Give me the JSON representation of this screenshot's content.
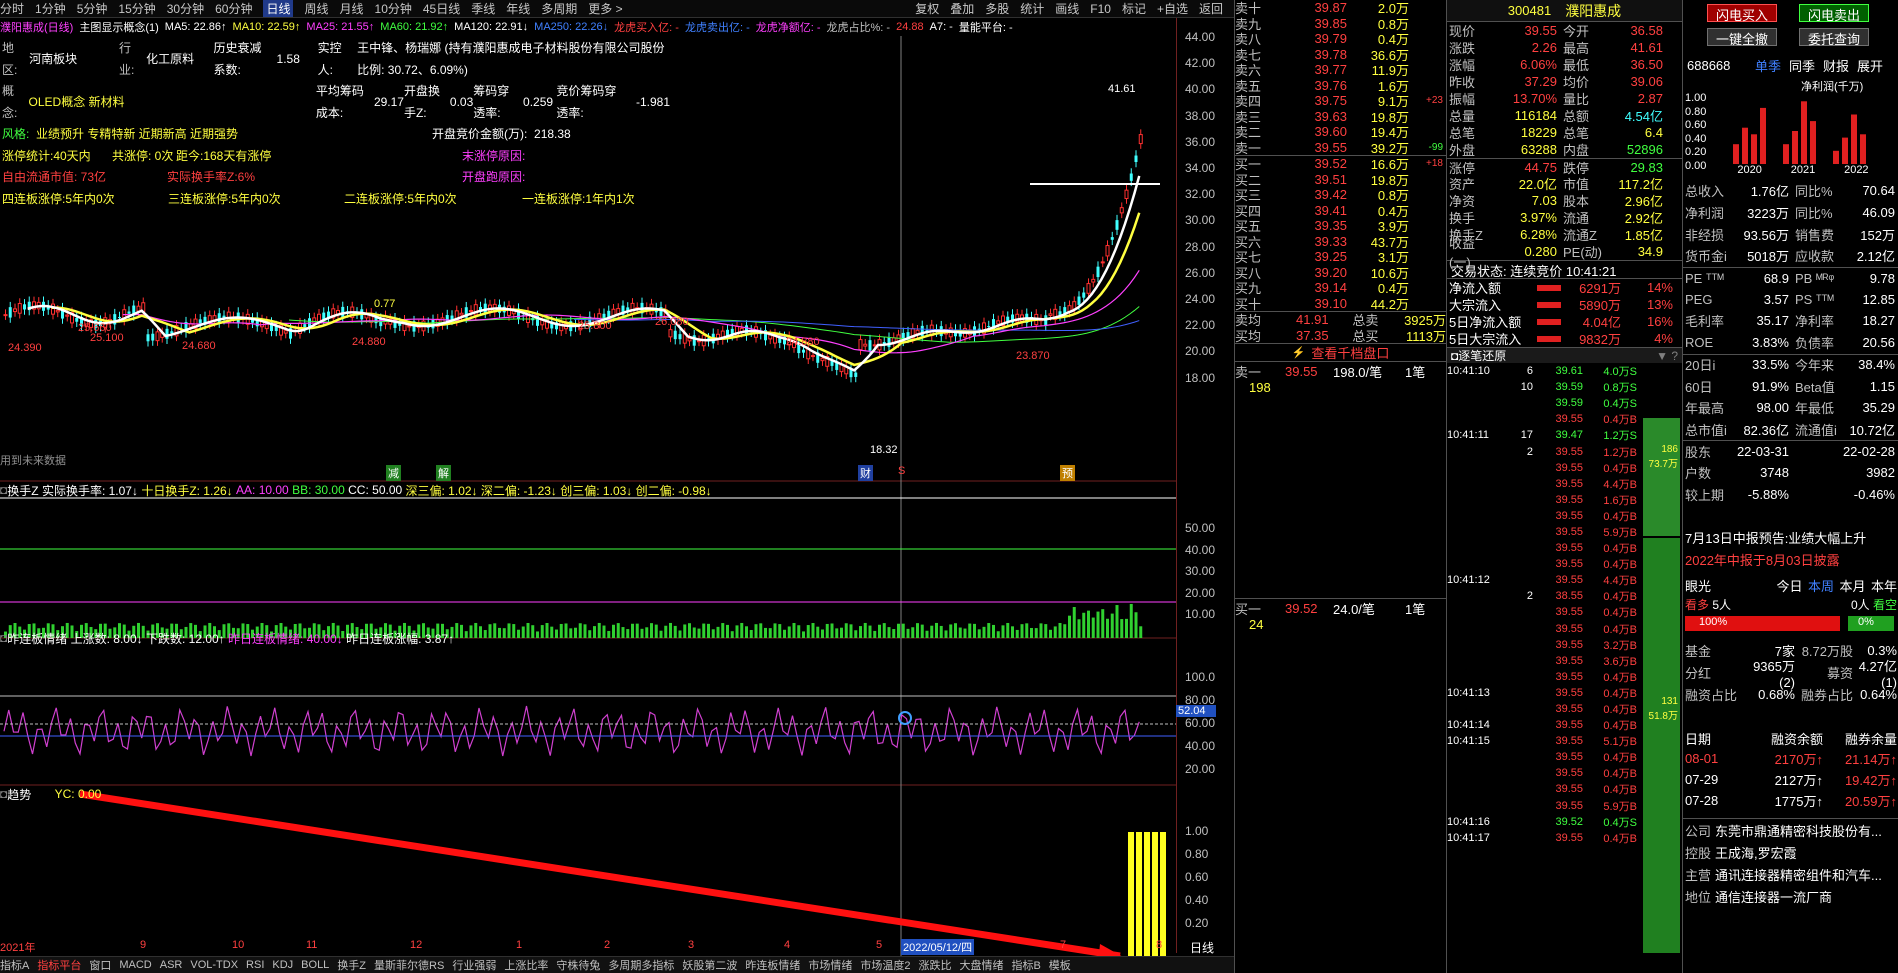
{
  "toolbar": {
    "items": [
      "分时",
      "1分钟",
      "5分钟",
      "15分钟",
      "30分钟",
      "60分钟",
      "日线",
      "周线",
      "月线",
      "10分钟",
      "45日线",
      "季线",
      "年线",
      "多周期",
      "更多 >"
    ],
    "active": "日线",
    "right": [
      "复权",
      "叠加",
      "多股",
      "统计",
      "画线",
      "F10",
      "标记",
      "+自选",
      "返回"
    ]
  },
  "ma_line": {
    "name": "濮阳惠成(日线)",
    "concept": "主图显示概念(1)",
    "ma5": "MA5: 22.86↑",
    "ma10": "MA10: 22.59↑",
    "ma25": "MA25: 21.55↑",
    "ma60": "MA60: 21.92↑",
    "ma120": "MA120: 22.91↓",
    "ma250": "MA250: 22.26↓",
    "a": "龙虎买入亿: -",
    "b": "龙虎卖出亿: -",
    "c": "龙虎净额亿: -",
    "d": "龙虎占比%: -",
    "e": "24.88",
    "f": "A7: -",
    "g": "量能平台: -"
  },
  "info": {
    "r1": [
      "地区:",
      "河南板块",
      "行业:",
      "化工原料",
      "历史衰减系数:",
      "1.58",
      "实控人:",
      "王中锋、杨瑞娜 (持有濮阳惠成电子材料股份有限公司股份比例: 30.72、6.09%)"
    ],
    "r2": [
      "概念:",
      "OLED概念 新材料",
      "平均筹码成本:",
      "29.17",
      "开盘换手Z:",
      "0.03",
      "筹码穿透率:",
      "0.259",
      "竞价筹码穿透率:",
      "-1.981"
    ],
    "r3": [
      "风格:",
      "业绩预升 专精特新 近期新高 近期强势",
      "开盘竞价金额(万):",
      "218.38"
    ],
    "r4": [
      "涨停统计:40天内",
      "共涨停: 0次",
      "距今:168天有涨停",
      "末涨停原因:"
    ],
    "r5": [
      "自由流通市值: 73亿",
      "实际换手率Z:6%",
      "开盘跑原因:"
    ],
    "r6": [
      "四连板涨停:5年内0次",
      "三连板涨停:5年内0次",
      "二连板涨停:5年内0次",
      "一连板涨停:1年内1次"
    ]
  },
  "chart_labels": {
    "hi": "41.61",
    "lo": "18.32",
    "p1": "24.390",
    "p2": "25.660",
    "p3": "25.100",
    "p4": "24.680",
    "p5": "24.880",
    "p6": "25.800",
    "p7": "26.080",
    "p8": "24.880",
    "p9": "23.870",
    "p10": "0.77",
    "note": "用到未来数据",
    "m1": "减",
    "m2": "解",
    "m3": "财",
    "m4": "S",
    "m5": "预"
  },
  "axis_main": [
    "44.00",
    "42.00",
    "40.00",
    "38.00",
    "36.00",
    "34.00",
    "32.00",
    "30.00",
    "28.00",
    "26.00",
    "24.00",
    "22.00",
    "20.00",
    "18.00"
  ],
  "panel2": {
    "title": "换手Z",
    "items": [
      "实际换手率: 1.07↓",
      "十日换手Z: 1.26↓",
      "AA: 10.00",
      "BB: 30.00",
      "CC: 50.00",
      "深三偏: 1.02↓",
      "深二偏: -1.23↓",
      "创三偏: 1.03↓",
      "创二偏: -0.98↓"
    ],
    "axis": [
      "50.00",
      "40.00",
      "30.00",
      "20.00",
      "10.00"
    ]
  },
  "panel3": {
    "title": "昨连板情绪",
    "items": [
      "上涨数: 8.00↓",
      "下跌数: 12.00↑",
      "昨日连板情绪: 40.00↓",
      "昨日连板涨幅: 3.87↑"
    ],
    "axis": [
      "100.0",
      "80.00",
      "60.00",
      "40.00",
      "20.00"
    ],
    "cur": "52.04"
  },
  "panel4": {
    "title": "趋势",
    "items": [
      "YC: 0.00"
    ],
    "axis": [
      "1.00",
      "0.80",
      "0.60",
      "0.40",
      "0.20"
    ]
  },
  "time_axis": {
    "labels": [
      "2021年",
      "9",
      "10",
      "11",
      "12",
      "1",
      "2",
      "3",
      "4",
      "5",
      "6",
      "7",
      "8"
    ],
    "cursor": "2022/05/12/四",
    "right": "日线"
  },
  "bottom_tabs": [
    "指标A",
    "指标平台",
    "窗口",
    "MACD",
    "ASR",
    "VOL-TDX",
    "RSI",
    "KDJ",
    "BOLL",
    "换手Z",
    "量斯菲尔德RS",
    "行业强弱",
    "上涨比率",
    "守株待兔",
    "多周期多指标",
    "妖股第二波",
    "昨连板情绪",
    "市场情绪",
    "市场温度2",
    "涨跌比",
    "大盘情绪",
    "指标B",
    "模板"
  ],
  "orderbook": {
    "sell": [
      [
        "卖十",
        "39.87",
        "2.0万",
        ""
      ],
      [
        "卖九",
        "39.85",
        "0.8万",
        ""
      ],
      [
        "卖八",
        "39.79",
        "0.4万",
        ""
      ],
      [
        "卖七",
        "39.78",
        "36.6万",
        ""
      ],
      [
        "卖六",
        "39.77",
        "11.9万",
        ""
      ],
      [
        "卖五",
        "39.76",
        "1.6万",
        ""
      ],
      [
        "卖四",
        "39.75",
        "9.1万",
        "+23"
      ],
      [
        "卖三",
        "39.63",
        "19.8万",
        ""
      ],
      [
        "卖二",
        "39.60",
        "19.4万",
        ""
      ],
      [
        "卖一",
        "39.55",
        "39.2万",
        "-99"
      ]
    ],
    "buy": [
      [
        "买一",
        "39.52",
        "16.6万",
        "+18"
      ],
      [
        "买二",
        "39.51",
        "19.8万",
        ""
      ],
      [
        "买三",
        "39.42",
        "0.8万",
        ""
      ],
      [
        "买四",
        "39.41",
        "0.4万",
        ""
      ],
      [
        "买五",
        "39.35",
        "3.9万",
        ""
      ],
      [
        "买六",
        "39.33",
        "43.7万",
        ""
      ],
      [
        "买七",
        "39.25",
        "3.1万",
        ""
      ],
      [
        "买八",
        "39.20",
        "10.6万",
        ""
      ],
      [
        "买九",
        "39.14",
        "0.4万",
        ""
      ],
      [
        "买十",
        "39.10",
        "44.2万",
        ""
      ]
    ],
    "avg": [
      [
        "卖均",
        "41.91",
        "总卖",
        "3925万"
      ],
      [
        "买均",
        "37.35",
        "总买",
        "1113万"
      ]
    ],
    "link": "查看千档盘口"
  },
  "queue": {
    "sell": [
      "卖一",
      "39.55",
      "198.0/笔",
      "1笔",
      "198"
    ],
    "buy": [
      "买一",
      "39.52",
      "24.0/笔",
      "1笔",
      "24"
    ]
  },
  "header": {
    "code": "300481",
    "name": "濮阳惠成"
  },
  "quote": [
    [
      "现价",
      "39.55",
      "今开",
      "36.58"
    ],
    [
      "涨跌",
      "2.26",
      "最高",
      "41.61"
    ],
    [
      "涨幅",
      "6.06%",
      "最低",
      "36.50"
    ],
    [
      "昨收",
      "37.29",
      "均价",
      "39.06"
    ],
    [
      "振幅",
      "13.70%",
      "量比",
      "2.87"
    ],
    [
      "总量",
      "116184",
      "总额",
      "4.54亿"
    ],
    [
      "总笔",
      "18229",
      "总笔",
      "6.4"
    ],
    [
      "外盘",
      "63288",
      "内盘",
      "52896"
    ],
    [
      "涨停",
      "44.75",
      "跌停",
      "29.83"
    ],
    [
      "资产",
      "22.0亿",
      "市值",
      "117.2亿"
    ],
    [
      "净资",
      "7.03",
      "股本",
      "2.96亿"
    ],
    [
      "换手",
      "3.97%",
      "流通",
      "2.92亿"
    ],
    [
      "换手Z",
      "6.28%",
      "流通Z",
      "1.85亿"
    ],
    [
      "收益(一)",
      "0.280",
      "PE(动)",
      "34.9"
    ]
  ],
  "status": "交易状态: 连续竞价  10:41:21",
  "flows": [
    [
      "净流入额",
      "6291万",
      "14%"
    ],
    [
      "大宗流入",
      "5890万",
      "13%"
    ],
    [
      "5日净流入额",
      "4.04亿",
      "16%"
    ],
    [
      "5日大宗流入",
      "9832万",
      "4%"
    ]
  ],
  "tick_title": "逐笔还原",
  "ticks": [
    [
      "10:41:10",
      "6",
      "39.61",
      "4.0万S"
    ],
    [
      "",
      "10",
      "39.59",
      "0.8万S"
    ],
    [
      "",
      "",
      "39.59",
      "0.4万S"
    ],
    [
      "",
      "",
      "39.55",
      "0.4万B"
    ],
    [
      "10:41:11",
      "17",
      "39.47",
      "1.2万S"
    ],
    [
      "",
      "2",
      "39.55",
      "1.2万B"
    ],
    [
      "",
      "",
      "39.55",
      "0.4万B"
    ],
    [
      "",
      "",
      "39.55",
      "4.4万B"
    ],
    [
      "",
      "",
      "39.55",
      "1.6万B"
    ],
    [
      "",
      "",
      "39.55",
      "0.4万B"
    ],
    [
      "",
      "",
      "39.55",
      "5.9万B"
    ],
    [
      "",
      "",
      "39.55",
      "0.4万B"
    ],
    [
      "",
      "",
      "39.55",
      "0.4万B"
    ],
    [
      "10:41:12",
      "",
      "39.55",
      "4.4万B"
    ],
    [
      "",
      "2",
      "38.55",
      "0.4万B"
    ],
    [
      "",
      "",
      "39.55",
      "0.4万B"
    ],
    [
      "",
      "",
      "39.55",
      "0.4万B"
    ],
    [
      "",
      "",
      "39.55",
      "3.2万B"
    ],
    [
      "",
      "",
      "39.55",
      "3.6万B"
    ],
    [
      "",
      "",
      "39.55",
      "0.4万B"
    ],
    [
      "10:41:13",
      "",
      "39.55",
      "0.4万B"
    ],
    [
      "",
      "",
      "39.55",
      "0.4万B"
    ],
    [
      "10:41:14",
      "",
      "39.55",
      "0.4万B"
    ],
    [
      "10:41:15",
      "",
      "39.55",
      "5.1万B"
    ],
    [
      "",
      "",
      "39.55",
      "0.4万B"
    ],
    [
      "",
      "",
      "39.55",
      "0.4万B"
    ],
    [
      "",
      "",
      "39.55",
      "0.4万B"
    ],
    [
      "",
      "",
      "39.55",
      "5.9万B"
    ],
    [
      "10:41:16",
      "",
      "39.52",
      "0.4万S"
    ],
    [
      "10:41:17",
      "",
      "39.55",
      "0.4万B"
    ]
  ],
  "tick_bars": [
    {
      "label": "186",
      "sub": "73.7万"
    },
    {
      "label": "131",
      "sub": "51.8万"
    }
  ],
  "rc": {
    "btn_buy": "闪电买入",
    "btn_sell": "闪电卖出",
    "btn_cancel": "一键全撤",
    "btn_query": "委托查询",
    "code": "688668",
    "tabs": [
      "单季",
      "同季",
      "财报",
      "展开"
    ],
    "chart_title": "净利润(千万)",
    "years": [
      "2020",
      "2021",
      "2022"
    ],
    "yaxis": [
      "1.00",
      "0.80",
      "0.60",
      "0.40",
      "0.20",
      "0.00"
    ],
    "fin": [
      [
        "总收入",
        "1.76亿",
        "同比%",
        "70.64"
      ],
      [
        "净利润",
        "3223万",
        "同比%",
        "46.09"
      ],
      [
        "非经损",
        "93.56万",
        "销售费",
        "152万"
      ],
      [
        "货币金i",
        "5018万",
        "应收款",
        "2.12亿"
      ],
      [
        "PE ᵀᵀᴹ",
        "68.9",
        "PB ᴹᴿᵠ",
        "9.78"
      ],
      [
        "PEG",
        "3.57",
        "PS ᵀᵀᴹ",
        "12.85"
      ],
      [
        "毛利率",
        "35.17",
        "净利率",
        "18.27"
      ],
      [
        "ROE",
        "3.83%",
        "负债率",
        "20.56"
      ],
      [
        "20日i",
        "33.5%",
        "今年来",
        "38.4%"
      ],
      [
        "60日",
        "91.9%",
        "Beta值",
        "1.15"
      ],
      [
        "年最高",
        "98.00",
        "年最低",
        "35.29"
      ],
      [
        "总市值i",
        "82.36亿",
        "流通值i",
        "10.72亿"
      ],
      [
        "股东",
        "22-03-31",
        "",
        "22-02-28"
      ],
      [
        "户数",
        "3748",
        "",
        "3982"
      ],
      [
        "较上期",
        "-5.88%",
        "",
        "-0.46%"
      ]
    ],
    "news1": "7月13日中报预告:业绩大幅上升",
    "news2": "2022年中报于8月03日披露",
    "eye": [
      "眼光",
      "今日",
      "本周",
      "本月",
      "本年"
    ],
    "eye2": [
      "看多",
      "5人",
      "",
      "0人",
      "看空"
    ],
    "bull": "100%",
    "bear": "0%",
    "fund": [
      [
        "基金",
        "7家",
        "8.72万股",
        "0.3%"
      ],
      [
        "分红",
        "9365万(2)",
        "募资",
        "4.27亿(1)"
      ],
      [
        "融资占比",
        "0.68%",
        "融券占比",
        "0.64%"
      ]
    ],
    "margin_head": [
      "日期",
      "融资余额",
      "融券余量"
    ],
    "margin": [
      [
        "08-01",
        "2170万↑",
        "21.14万↑"
      ],
      [
        "07-29",
        "2127万↑",
        "19.42万↑"
      ],
      [
        "07-28",
        "1775万↑",
        "20.59万↑"
      ]
    ],
    "company": [
      [
        "公司",
        "东莞市鼎通精密科技股份有..."
      ],
      [
        "控股",
        "王成海,罗宏霞"
      ],
      [
        "主营",
        "通讯连接器精密组件和汽车..."
      ],
      [
        "地位",
        "通信连接器一流厂商"
      ]
    ]
  }
}
